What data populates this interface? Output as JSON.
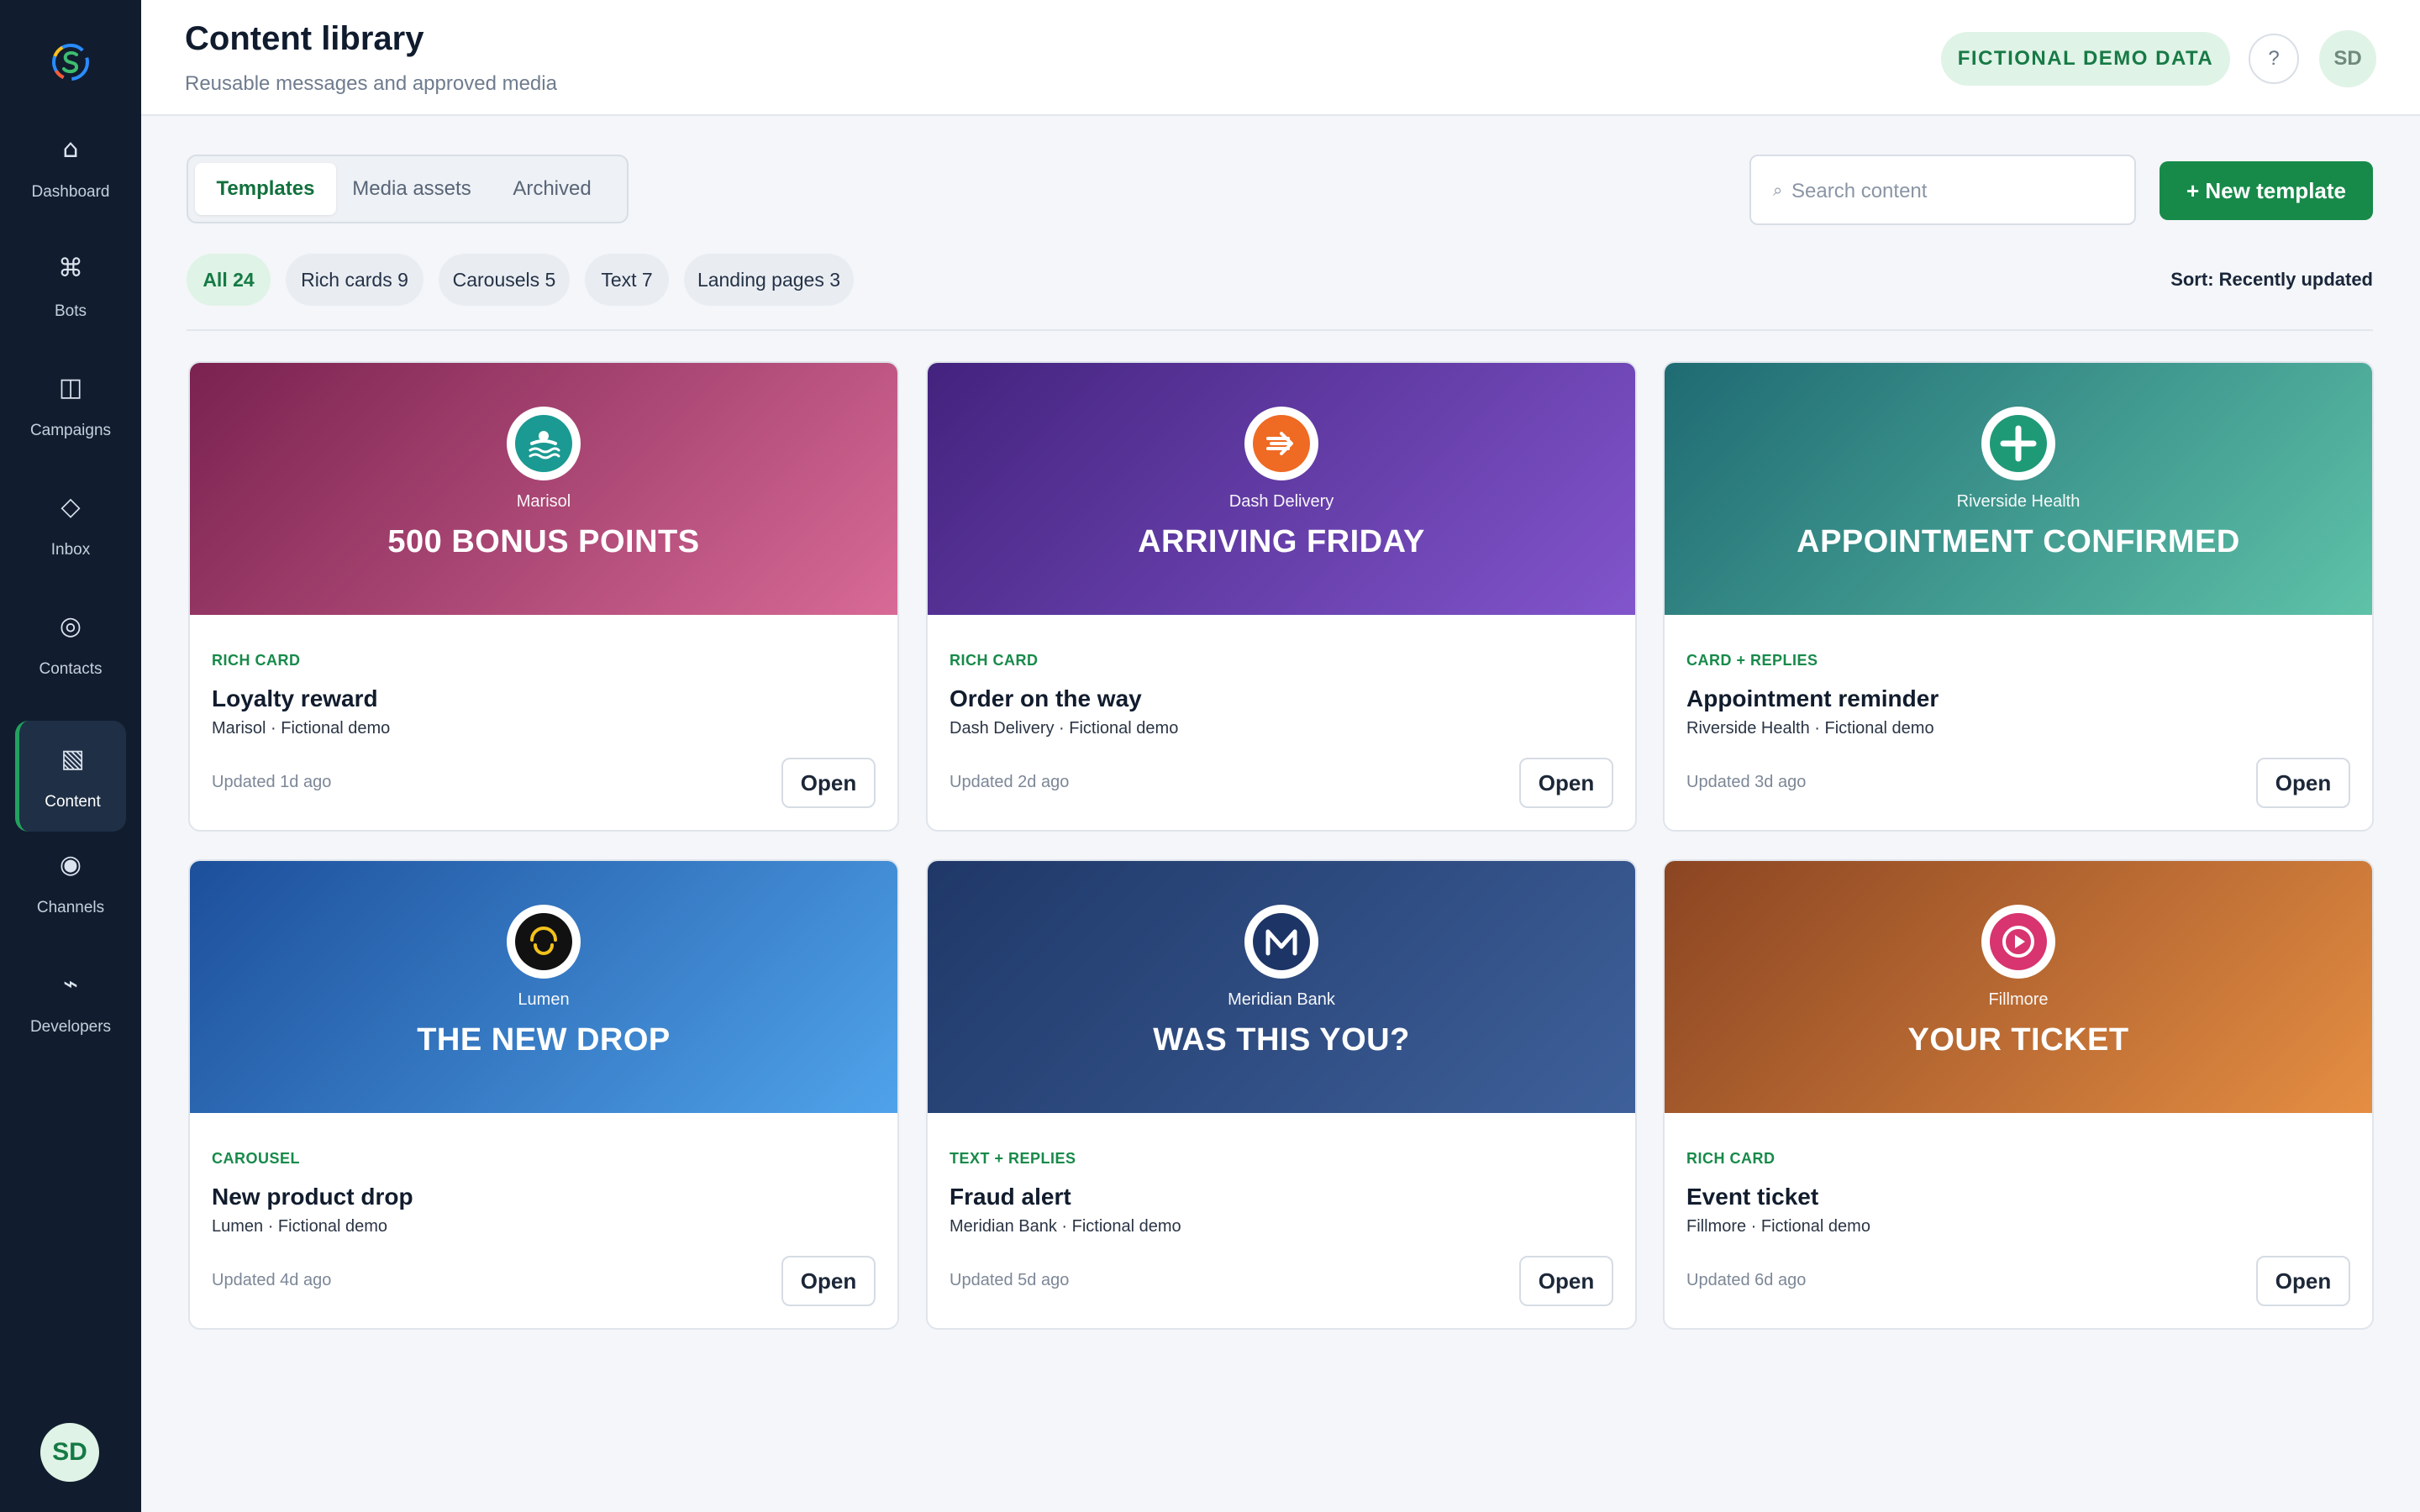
{
  "sidebar": {
    "items": [
      {
        "label": "Dashboard",
        "icon": "⌂"
      },
      {
        "label": "Bots",
        "icon": "⌘"
      },
      {
        "label": "Campaigns",
        "icon": "◫"
      },
      {
        "label": "Inbox",
        "icon": "◇"
      },
      {
        "label": "Contacts",
        "icon": "◎"
      },
      {
        "label": "Content",
        "icon": "▧"
      },
      {
        "label": "Channels",
        "icon": "◉"
      },
      {
        "label": "Developers",
        "icon": "⌁"
      }
    ],
    "active": "Content",
    "user_initials": "SD"
  },
  "header": {
    "title": "Content library",
    "subtitle": "Reusable messages and approved media",
    "demo_badge": "FICTIONAL DEMO DATA",
    "help_label": "?",
    "user_initials": "SD"
  },
  "tabs": [
    "Templates",
    "Media assets",
    "Archived"
  ],
  "active_tab": "Templates",
  "search": {
    "icon": "⌕",
    "placeholder": "Search content"
  },
  "new_button": "+ New template",
  "filters": [
    "All 24",
    "Rich cards 9",
    "Carousels 5",
    "Text 7",
    "Landing pages 3"
  ],
  "active_filter": "All 24",
  "sort_label": "Sort: Recently updated",
  "open_label": "Open",
  "cards": [
    {
      "brand": "Marisol",
      "banner": "500 BONUS POINTS",
      "type": "RICH CARD",
      "title": "Loyalty reward",
      "meta": "Marisol · Fictional demo",
      "updated": "Updated 1d ago",
      "icon": "swim-icon",
      "grad_from": "#7a2250",
      "grad_to": "#d86a96",
      "logo_color": "#1a9a92"
    },
    {
      "brand": "Dash Delivery",
      "banner": "ARRIVING FRIDAY",
      "type": "RICH CARD",
      "title": "Order on the way",
      "meta": "Dash Delivery · Fictional demo",
      "updated": "Updated 2d ago",
      "icon": "speed-arrow-icon",
      "grad_from": "#43237e",
      "grad_to": "#8255cc",
      "logo_color": "#ef6a23"
    },
    {
      "brand": "Riverside Health",
      "banner": "APPOINTMENT CONFIRMED",
      "type": "CARD + REPLIES",
      "title": "Appointment reminder",
      "meta": "Riverside Health · Fictional demo",
      "updated": "Updated 3d ago",
      "icon": "plus-icon",
      "grad_from": "#1f6b73",
      "grad_to": "#5ec2a8",
      "logo_color": "#1f9a76"
    },
    {
      "brand": "Lumen",
      "banner": "THE NEW DROP",
      "type": "CAROUSEL",
      "title": "New product drop",
      "meta": "Lumen · Fictional demo",
      "updated": "Updated 4d ago",
      "icon": "smile-icon",
      "grad_from": "#1d4f9b",
      "grad_to": "#4fa3ea",
      "logo_color": "#111111"
    },
    {
      "brand": "Meridian Bank",
      "banner": "WAS THIS YOU?",
      "type": "TEXT + REPLIES",
      "title": "Fraud alert",
      "meta": "Meridian Bank · Fictional demo",
      "updated": "Updated 5d ago",
      "icon": "letter-m-icon",
      "grad_from": "#1f3868",
      "grad_to": "#3e609a",
      "logo_color": "#1d3566"
    },
    {
      "brand": "Fillmore",
      "banner": "YOUR TICKET",
      "type": "RICH CARD",
      "title": "Event ticket",
      "meta": "Fillmore · Fictional demo",
      "updated": "Updated 6d ago",
      "icon": "play-icon",
      "grad_from": "#8b4522",
      "grad_to": "#e58e43",
      "logo_color": "#d8346f"
    }
  ]
}
